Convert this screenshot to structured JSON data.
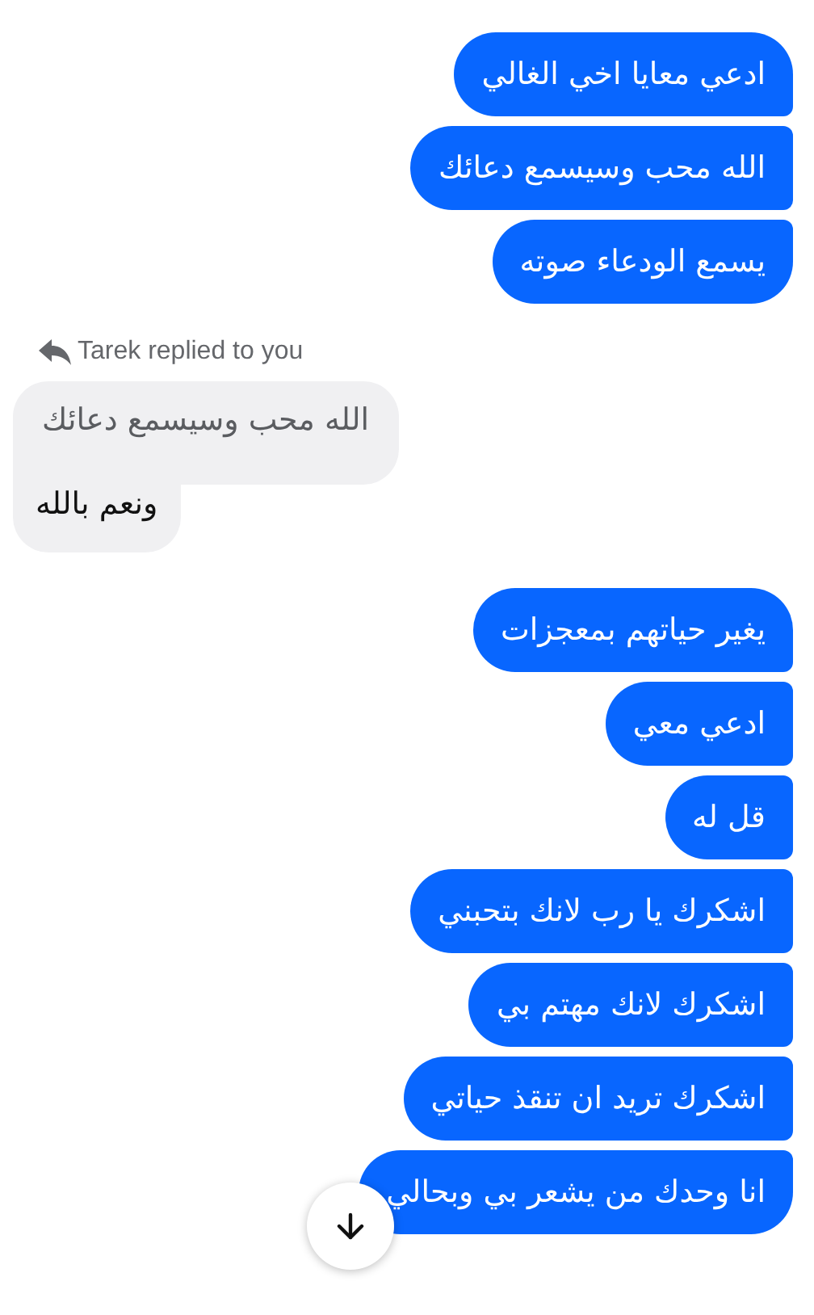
{
  "groups": [
    {
      "kind": "sent",
      "messages": [
        "ادعي معايا اخي الغالي",
        "الله محب وسيسمع دعائك",
        "يسمع الودعاء صوته"
      ]
    },
    {
      "kind": "reply",
      "label": "Tarek replied to you",
      "quoted": "الله محب وسيسمع دعائك",
      "message": "ونعم بالله"
    },
    {
      "kind": "sent",
      "messages": [
        "يغير حياتهم بمعجزات",
        "ادعي معي",
        "قل له",
        "اشكرك يا رب لانك بتحبني",
        "اشكرك لانك مهتم بي",
        "اشكرك تريد ان تنقذ حياتي",
        "انا وحدك من يشعر بي وبحالي"
      ]
    }
  ]
}
